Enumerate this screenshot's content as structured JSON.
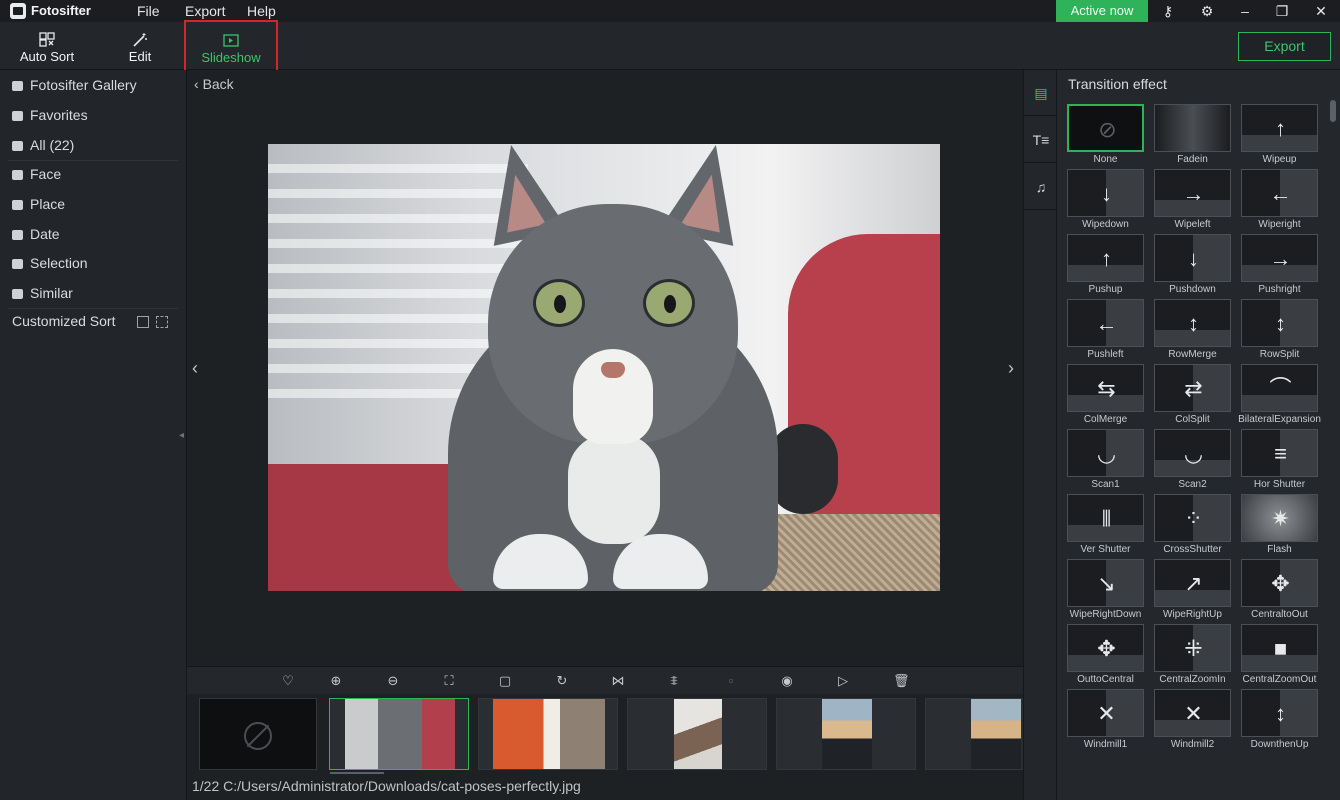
{
  "app": {
    "name": "Fotosifter"
  },
  "menu": [
    "File",
    "Export",
    "Help"
  ],
  "titlebar": {
    "active_label": "Active now"
  },
  "toolbar": {
    "auto_sort": "Auto Sort",
    "edit": "Edit",
    "slideshow": "Slideshow",
    "export": "Export"
  },
  "sidebar": {
    "items": [
      {
        "label": "Fotosifter Gallery"
      },
      {
        "label": "Favorites"
      },
      {
        "label": "All (22)"
      },
      {
        "label": "Face"
      },
      {
        "label": "Place"
      },
      {
        "label": "Date"
      },
      {
        "label": "Selection"
      },
      {
        "label": "Similar"
      }
    ],
    "customized_sort": "Customized Sort"
  },
  "main": {
    "back_label": "Back",
    "status": "1/22  C:/Users/Administrator/Downloads/cat-poses-perfectly.jpg"
  },
  "panel": {
    "title": "Transition effect",
    "effects": [
      "None",
      "Fadein",
      "Wipeup",
      "Wipedown",
      "Wipeleft",
      "Wiperight",
      "Pushup",
      "Pushdown",
      "Pushright",
      "Pushleft",
      "RowMerge",
      "RowSplit",
      "ColMerge",
      "ColSplit",
      "BilateralExpansion",
      "Scan1",
      "Scan2",
      "Hor Shutter",
      "Ver Shutter",
      "CrossShutter",
      "Flash",
      "WipeRightDown",
      "WipeRightUp",
      "CentraltoOut",
      "OuttoCentral",
      "CentralZoomIn",
      "CentralZoomOut",
      "Windmill1",
      "Windmill2",
      "DownthenUp"
    ],
    "selected_effect": "None"
  },
  "colors": {
    "accent": "#2fb35a",
    "highlight_border": "#d4262a"
  }
}
